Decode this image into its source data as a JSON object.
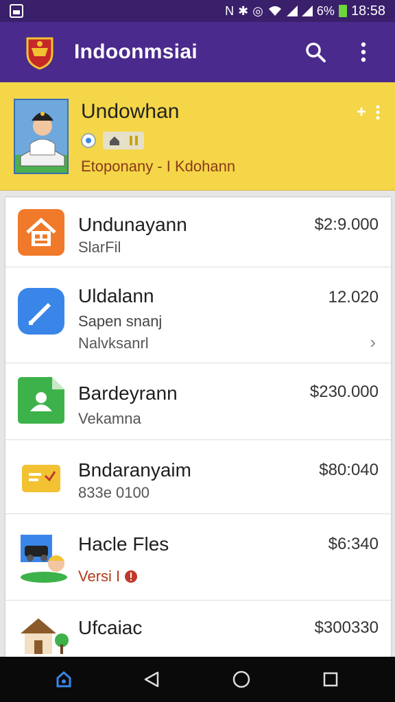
{
  "status_bar": {
    "indicator_text": "N",
    "battery": "6%",
    "time": "18:58"
  },
  "app_bar": {
    "title": "Indoonmsiai",
    "search_icon": "search-icon",
    "more_icon": "more-vert-icon"
  },
  "profile": {
    "name": "Undowhan",
    "subtitle": "Etoponany - I Kdohann",
    "accent": "#f4d648"
  },
  "list": [
    {
      "title": "Undunayann",
      "subtitle": "SlarFil",
      "amount": "$2:9.000",
      "icon": "house-icon",
      "icon_color": "#f07a2a"
    },
    {
      "title": "Uldalann",
      "subtitle": "Sapen snanj",
      "subtitle2": "Nalvksanrl",
      "amount": "12.020",
      "icon": "pencil-icon",
      "icon_color": "#3a86e8"
    },
    {
      "title": "Bardeyrann",
      "subtitle": "Vekamna",
      "amount": "$230.000",
      "icon": "document-icon",
      "icon_color": "#3db24a"
    },
    {
      "title": "Bndaranyaim",
      "subtitle": "833e 0100",
      "amount": "$80:040",
      "icon": "folder-icon",
      "icon_color": "#f2c232"
    },
    {
      "title": "Hacle Fles",
      "subtitle": "Versi I",
      "amount": "$6:340",
      "icon": "people-icon",
      "icon_color": "#4caf50"
    },
    {
      "title": "Ufcaiac",
      "subtitle": "",
      "amount": "$300330",
      "icon": "villa-icon",
      "icon_color": "#8b5a2b"
    }
  ],
  "nav": {
    "back": "back-icon",
    "home": "home-icon",
    "recents": "recents-icon"
  }
}
